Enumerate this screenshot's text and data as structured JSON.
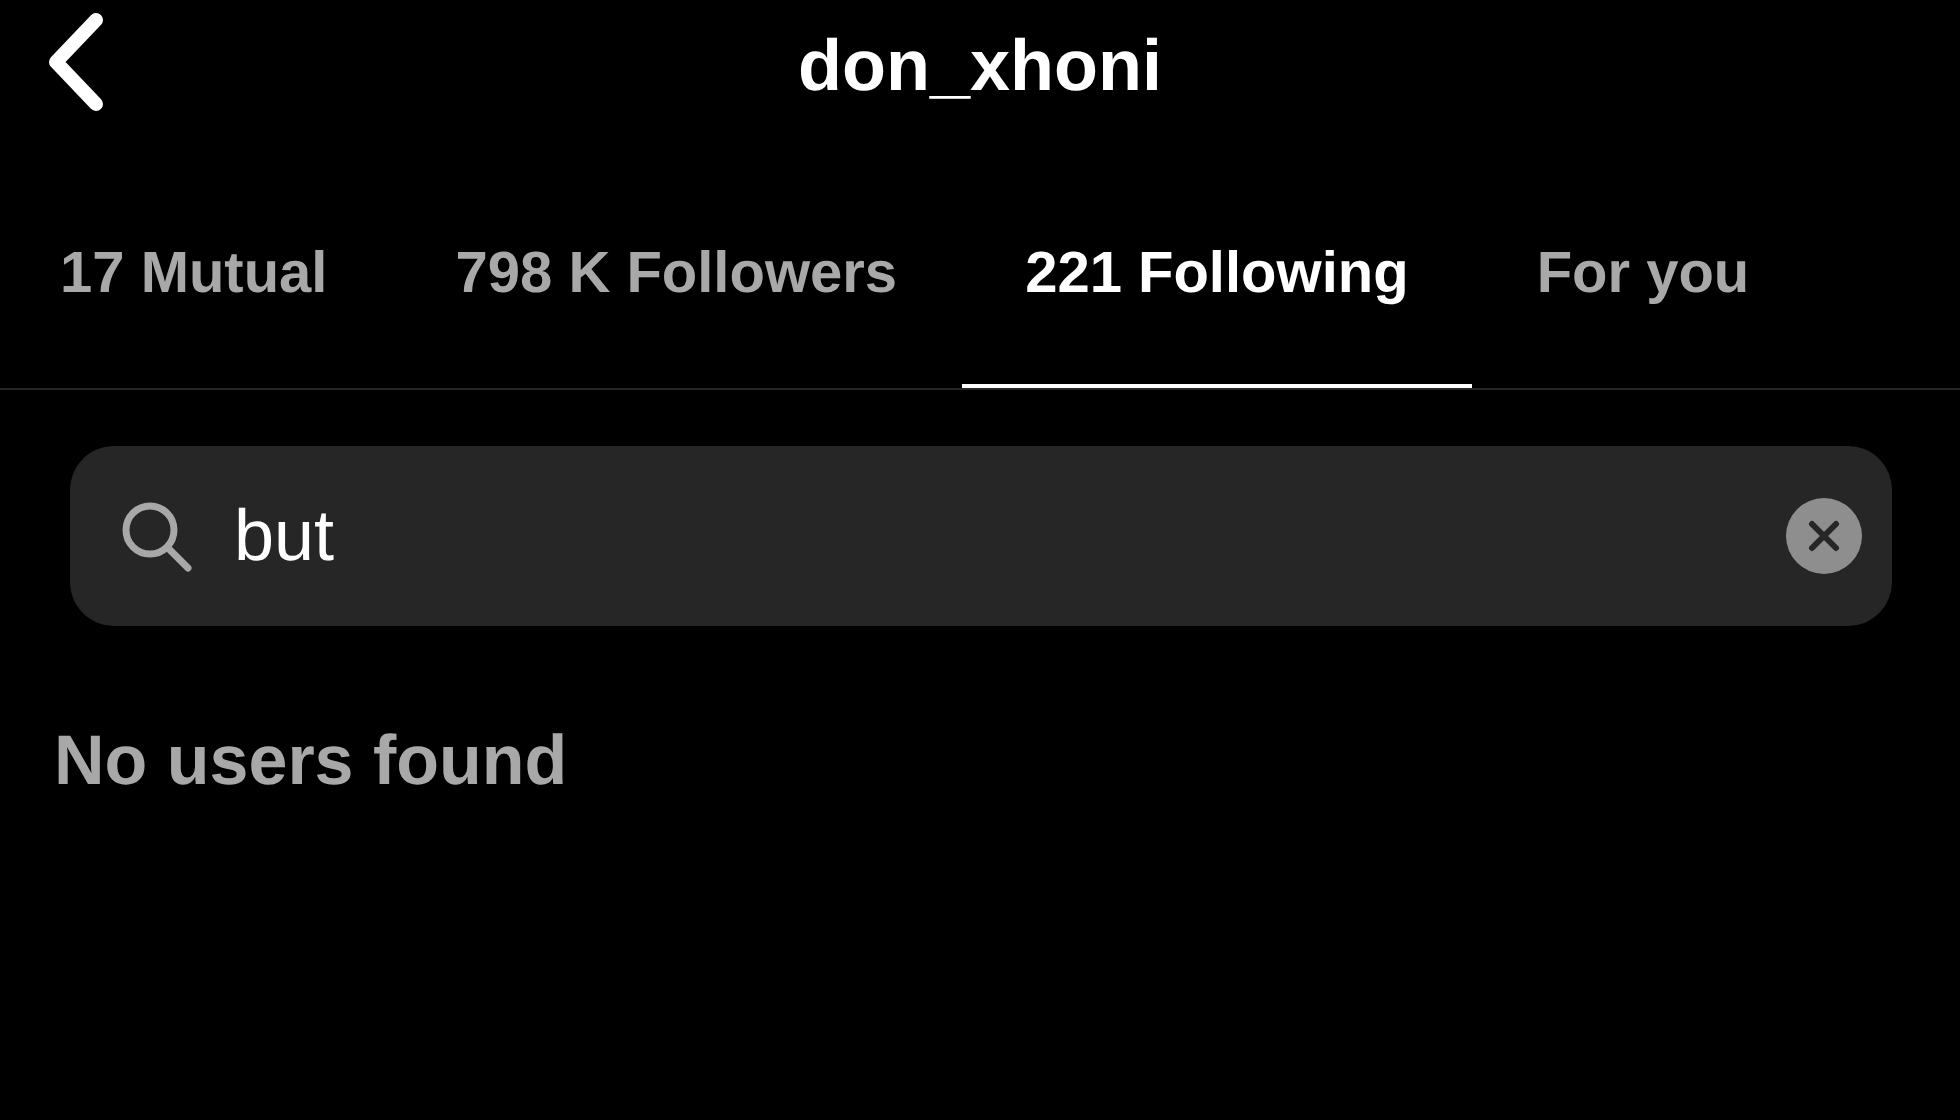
{
  "header": {
    "title": "don_xhoni"
  },
  "tabs": [
    {
      "label": "17 Mutual",
      "selected": false
    },
    {
      "label": "798 K Followers",
      "selected": false
    },
    {
      "label": "221 Following",
      "selected": true
    },
    {
      "label": "For you",
      "selected": false
    }
  ],
  "search": {
    "value": "but"
  },
  "empty_message": "No users found"
}
